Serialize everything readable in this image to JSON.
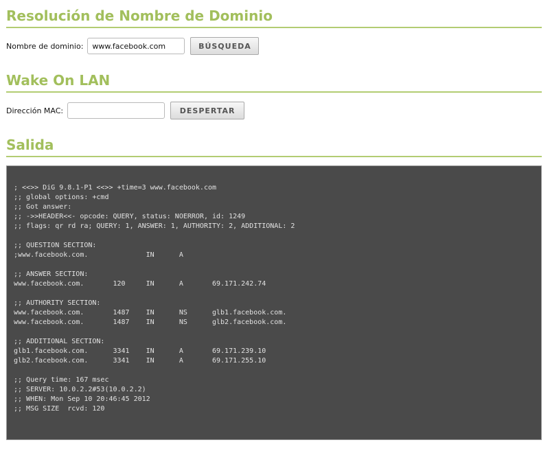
{
  "dns": {
    "title": "Resolución de Nombre de Dominio",
    "label": "Nombre de dominio:",
    "value": "www.facebook.com",
    "button": "BÚSQUEDA"
  },
  "wol": {
    "title": "Wake On LAN",
    "label": "Dirección MAC:",
    "value": "",
    "button": "DESPERTAR"
  },
  "output": {
    "title": "Salida",
    "text": "; <<>> DiG 9.8.1-P1 <<>> +time=3 www.facebook.com\n;; global options: +cmd\n;; Got answer:\n;; ->>HEADER<<- opcode: QUERY, status: NOERROR, id: 1249\n;; flags: qr rd ra; QUERY: 1, ANSWER: 1, AUTHORITY: 2, ADDITIONAL: 2\n\n;; QUESTION SECTION:\n;www.facebook.com.              IN      A\n\n;; ANSWER SECTION:\nwww.facebook.com.       120     IN      A       69.171.242.74\n\n;; AUTHORITY SECTION:\nwww.facebook.com.       1487    IN      NS      glb1.facebook.com.\nwww.facebook.com.       1487    IN      NS      glb2.facebook.com.\n\n;; ADDITIONAL SECTION:\nglb1.facebook.com.      3341    IN      A       69.171.239.10\nglb2.facebook.com.      3341    IN      A       69.171.255.10\n\n;; Query time: 167 msec\n;; SERVER: 10.0.2.2#53(10.0.2.2)\n;; WHEN: Mon Sep 10 20:46:45 2012\n;; MSG SIZE  rcvd: 120"
  },
  "colors": {
    "heading": "#a2bf5c",
    "rule": "#b2cc72",
    "output_bg": "#4a4a4a",
    "output_text": "#e2e2e2"
  }
}
